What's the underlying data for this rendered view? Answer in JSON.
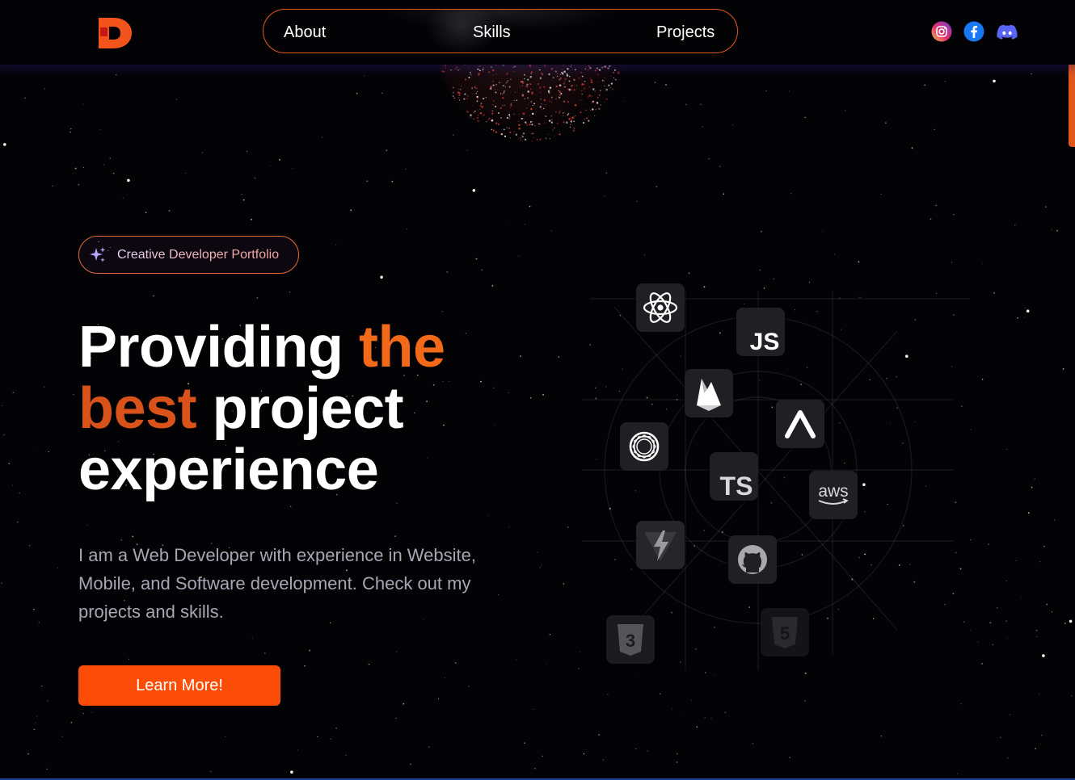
{
  "header": {
    "logo_icon": "d-logo-icon",
    "nav": [
      {
        "label": "About"
      },
      {
        "label": "Skills"
      },
      {
        "label": "Projects"
      }
    ],
    "socials": [
      {
        "icon": "instagram-icon",
        "color": "#e1306c"
      },
      {
        "icon": "facebook-icon",
        "color": "#1877f2"
      },
      {
        "icon": "discord-icon",
        "color": "#5865f2"
      }
    ]
  },
  "hero": {
    "badge": {
      "icon": "sparkles-icon",
      "text": "Creative Developer Portfolio"
    },
    "headline": {
      "part1": "Providing",
      "part2": "the",
      "part3": "best",
      "part4": "project",
      "part5": "experience"
    },
    "description": "I am a Web Developer with experience in Website, Mobile, and Software development. Check out my projects and skills.",
    "cta_label": "Learn More!"
  },
  "skills": {
    "tiles": [
      {
        "icon": "react-icon"
      },
      {
        "icon": "javascript-icon",
        "text": "JS"
      },
      {
        "icon": "firebase-icon"
      },
      {
        "icon": "openai-icon"
      },
      {
        "icon": "expo-icon"
      },
      {
        "icon": "typescript-icon",
        "text": "TS"
      },
      {
        "icon": "aws-icon",
        "text": "aws"
      },
      {
        "icon": "vite-icon"
      },
      {
        "icon": "github-icon"
      },
      {
        "icon": "css3-icon"
      },
      {
        "icon": "html5-icon"
      }
    ]
  },
  "colors": {
    "accent": "#fc4d08",
    "accent_text": "#f3691a",
    "background": "#030306",
    "muted_text": "#a5a7b4"
  }
}
